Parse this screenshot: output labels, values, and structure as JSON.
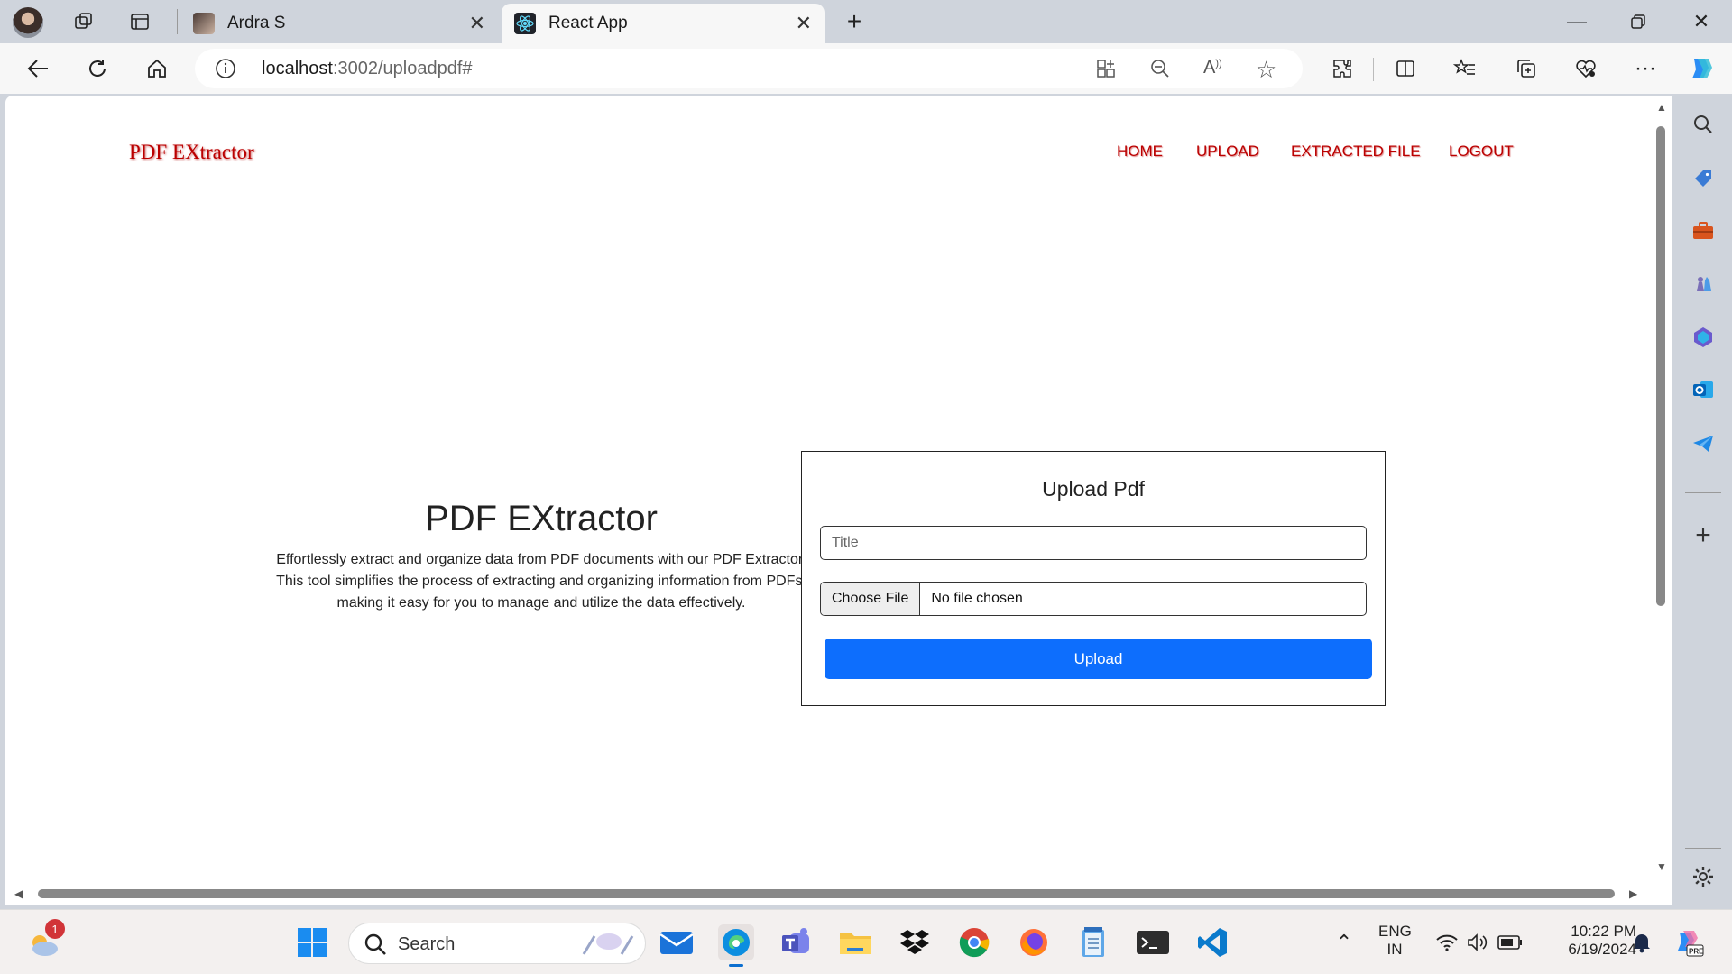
{
  "browser": {
    "tabs": [
      {
        "label": "Ardra S",
        "active": false
      },
      {
        "label": "React App",
        "active": true
      }
    ],
    "address": {
      "host": "localhost",
      "rest": ":3002/uploadpdf#"
    }
  },
  "page": {
    "brand": "PDF EXtractor",
    "nav": [
      "HOME",
      "UPLOAD",
      "EXTRACTED FILE",
      "LOGOUT"
    ],
    "hero": {
      "title": "PDF EXtractor",
      "line1": "Effortlessly extract and organize data from PDF documents with our PDF Extractor.",
      "line2": "This tool simplifies the process of extracting and organizing information from PDFs,",
      "line3": "making it easy for you to manage and utilize the data effectively."
    },
    "upload_form": {
      "heading": "Upload Pdf",
      "title_placeholder": "Title",
      "choose_file_label": "Choose File",
      "file_status": "No file chosen",
      "submit_label": "Upload"
    }
  },
  "taskbar": {
    "search_label": "Search",
    "weather_badge": "1",
    "language": {
      "line1": "ENG",
      "line2": "IN"
    },
    "time": "10:22 PM",
    "date": "6/19/2024"
  },
  "colors": {
    "accent": "#0d6efd",
    "brand_red": "#bb0000"
  }
}
